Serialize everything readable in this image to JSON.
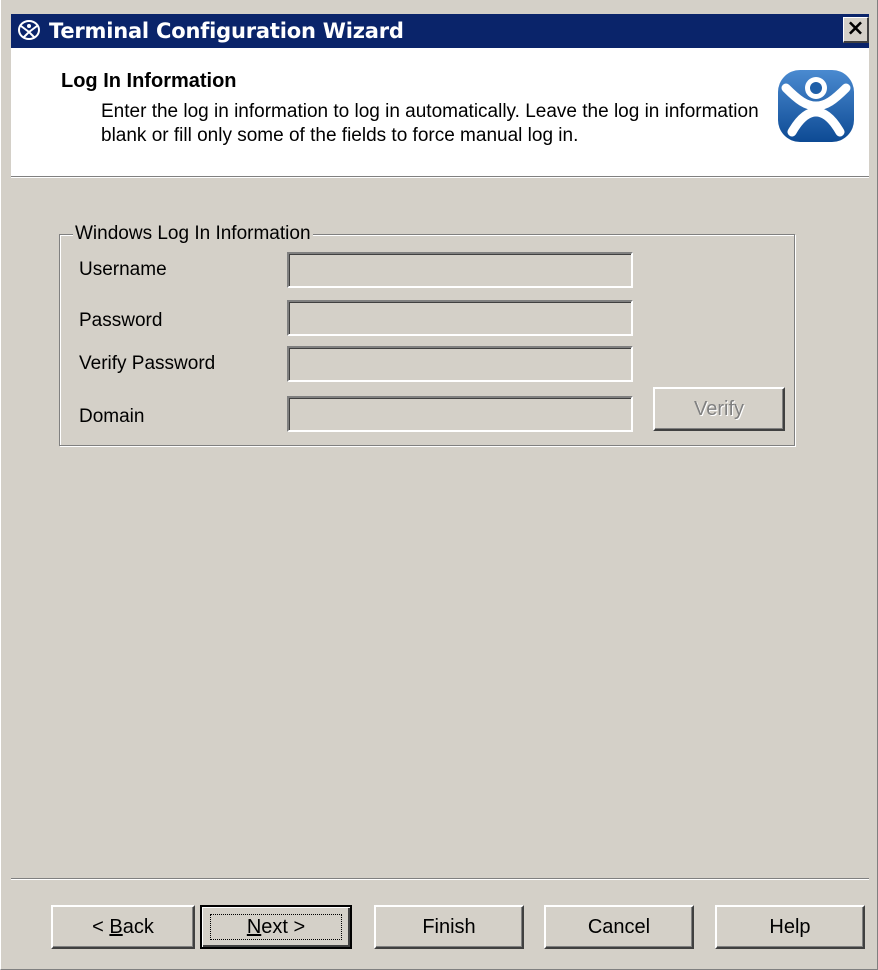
{
  "window": {
    "title": "Terminal Configuration Wizard",
    "close_label": "×"
  },
  "header": {
    "title": "Log In Information",
    "description": "Enter the log in information to log in automatically. Leave the log in information blank or fill only some of the fields to force manual log in."
  },
  "group": {
    "legend": "Windows Log In Information",
    "fields": {
      "username": {
        "label": "Username",
        "value": ""
      },
      "password": {
        "label": "Password",
        "value": ""
      },
      "verify_password": {
        "label": "Verify Password",
        "value": ""
      },
      "domain": {
        "label": "Domain",
        "value": ""
      }
    },
    "verify_button": "Verify"
  },
  "footer": {
    "back": {
      "prefix": "< ",
      "mnemonic": "B",
      "rest": "ack"
    },
    "next": {
      "mnemonic": "N",
      "rest": "ext >"
    },
    "finish": "Finish",
    "cancel": "Cancel",
    "help": "Help"
  },
  "colors": {
    "titlebar": "#0a246a",
    "dialog_face": "#d4d0c8",
    "logo_blue": "#1f5fa8"
  }
}
